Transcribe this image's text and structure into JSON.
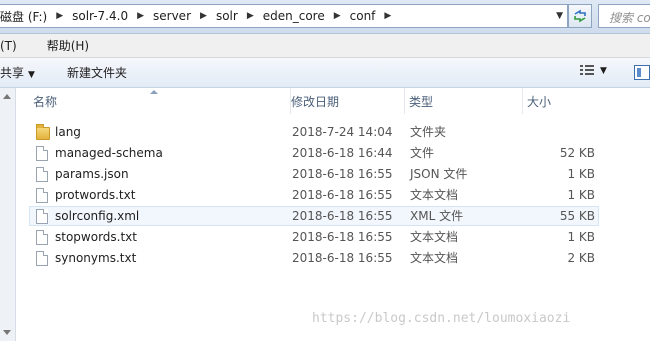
{
  "address_bar": {
    "crumbs": [
      "磁盘 (F:)",
      "solr-7.4.0",
      "server",
      "solr",
      "eden_core",
      "conf"
    ],
    "search_placeholder": "搜索 co"
  },
  "menu": {
    "items": [
      "(T)",
      "帮助(H)"
    ]
  },
  "toolbar": {
    "share_label": "共享",
    "new_folder_label": "新建文件夹"
  },
  "columns": {
    "name": "名称",
    "date": "修改日期",
    "type": "类型",
    "size": "大小"
  },
  "files": [
    {
      "name": "lang",
      "date": "2018-7-24 14:04",
      "type": "文件夹",
      "size": "",
      "icon": "folder-icon"
    },
    {
      "name": "managed-schema",
      "date": "2018-6-18 16:44",
      "type": "文件",
      "size": "52 KB",
      "icon": "file-icon"
    },
    {
      "name": "params.json",
      "date": "2018-6-18 16:55",
      "type": "JSON 文件",
      "size": "1 KB",
      "icon": "file-icon"
    },
    {
      "name": "protwords.txt",
      "date": "2018-6-18 16:55",
      "type": "文本文档",
      "size": "1 KB",
      "icon": "file-icon"
    },
    {
      "name": "solrconfig.xml",
      "date": "2018-6-18 16:55",
      "type": "XML 文件",
      "size": "55 KB",
      "icon": "file-icon",
      "selected": true
    },
    {
      "name": "stopwords.txt",
      "date": "2018-6-18 16:55",
      "type": "文本文档",
      "size": "1 KB",
      "icon": "file-icon"
    },
    {
      "name": "synonyms.txt",
      "date": "2018-6-18 16:55",
      "type": "文本文档",
      "size": "2 KB",
      "icon": "file-icon"
    }
  ],
  "watermark": "https://blog.csdn.net/loumoxiaozi",
  "colors": {
    "address_bg": "#dfe9f5",
    "selected_row": "#f2f7fd",
    "header_text": "#4c607a"
  }
}
